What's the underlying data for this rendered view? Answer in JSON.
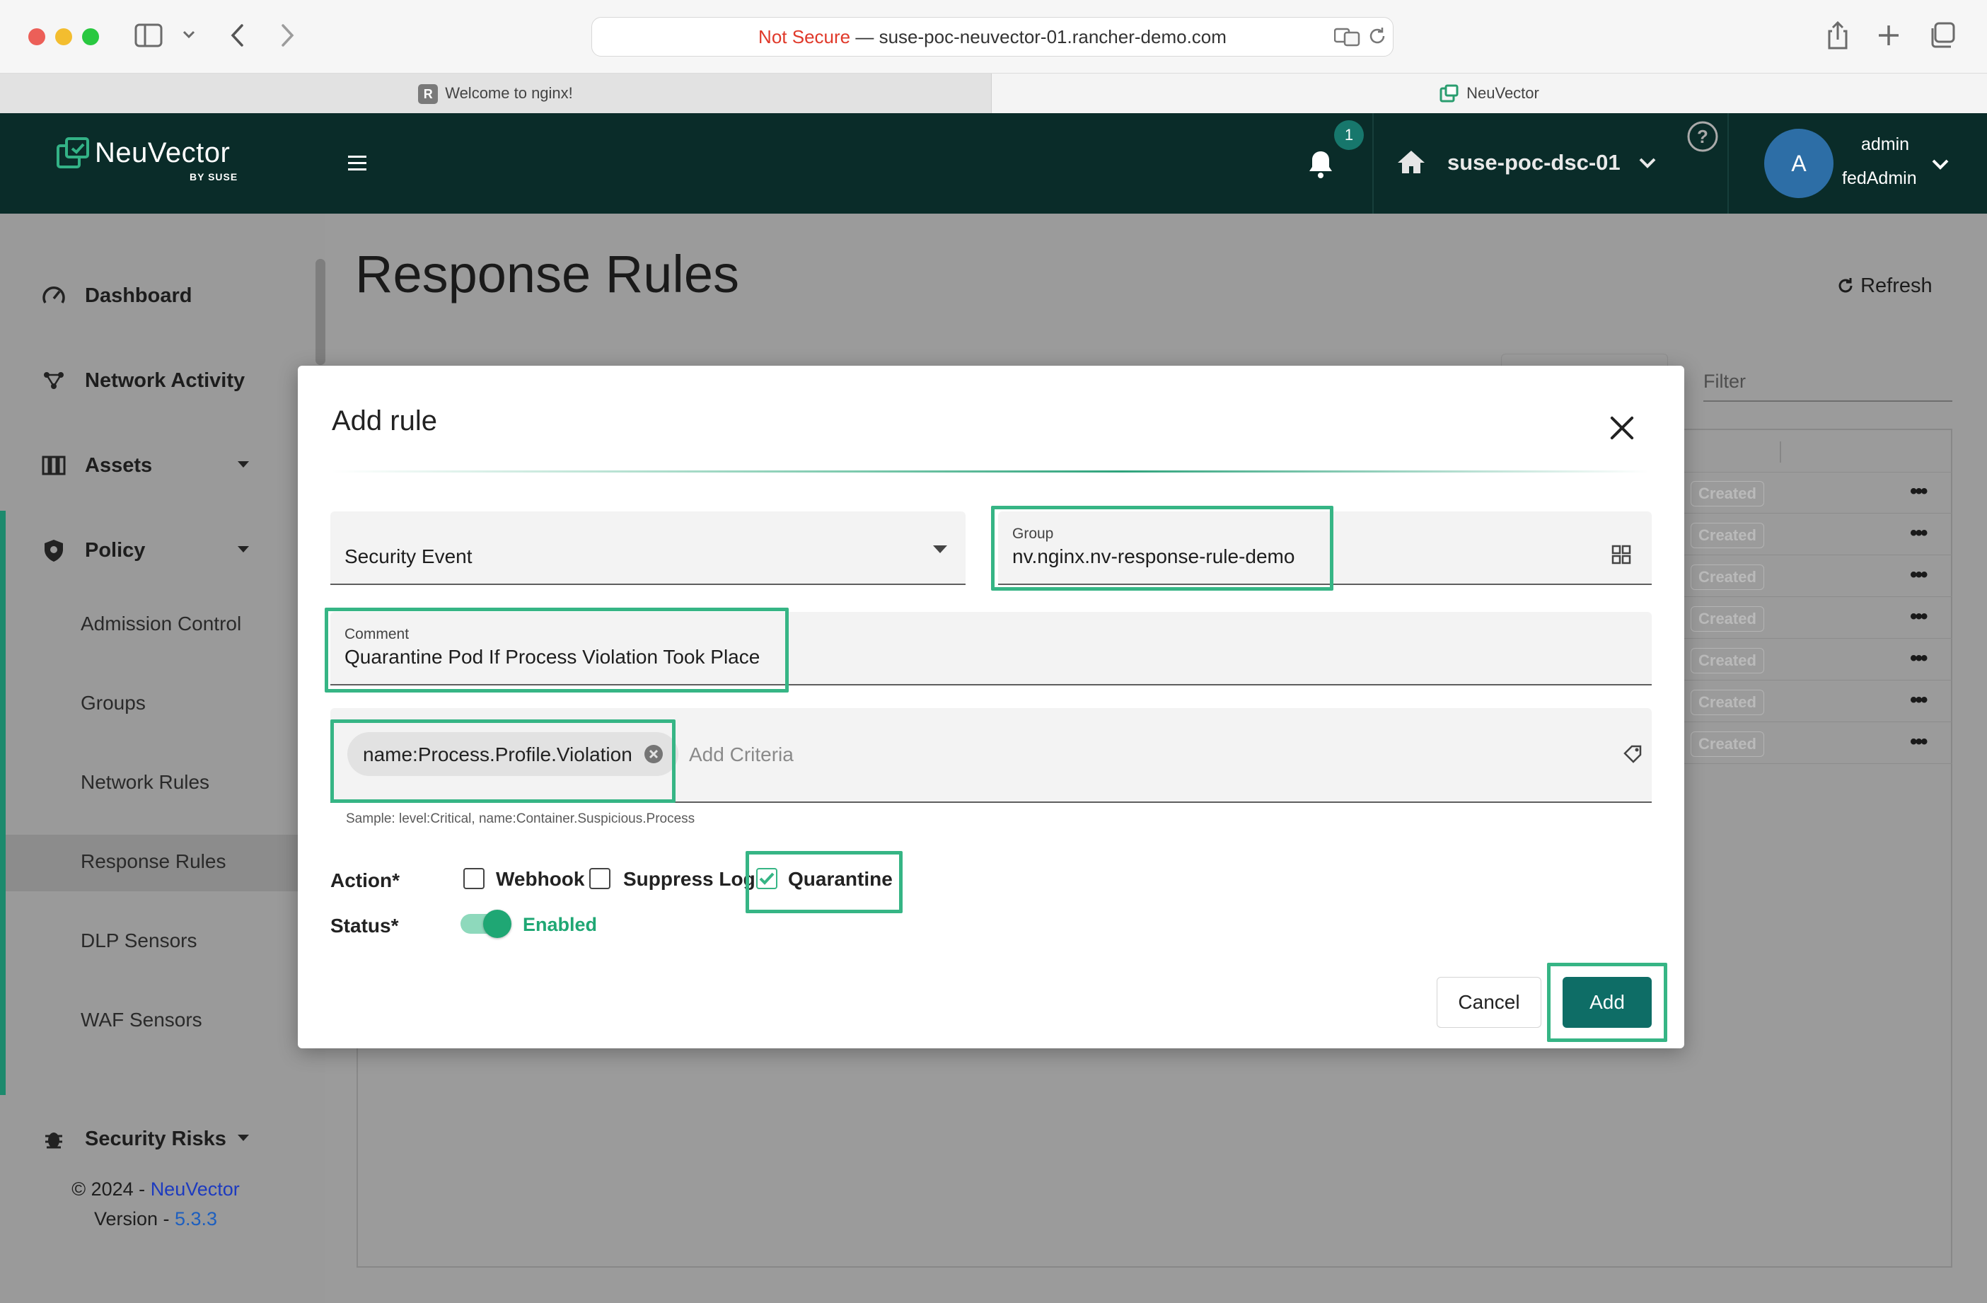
{
  "browser": {
    "url_warning": "Not Secure",
    "url_separator": "—",
    "url_host": "suse-poc-neuvector-01.rancher-demo.com",
    "tabs": [
      {
        "label": "Welcome to nginx!",
        "favicon": "R"
      },
      {
        "label": "NeuVector"
      }
    ]
  },
  "app": {
    "logo_text": "NeuVector",
    "logo_sub": "BY SUSE",
    "notification_count": "1",
    "cluster_name": "suse-poc-dsc-01",
    "user": {
      "initial": "A",
      "name": "admin",
      "role": "fedAdmin"
    }
  },
  "sidebar": {
    "items": [
      {
        "label": "Dashboard"
      },
      {
        "label": "Network Activity"
      },
      {
        "label": "Assets"
      },
      {
        "label": "Policy"
      }
    ],
    "policy_sub": [
      {
        "label": "Admission Control"
      },
      {
        "label": "Groups"
      },
      {
        "label": "Network Rules"
      },
      {
        "label": "Response Rules"
      },
      {
        "label": "DLP Sensors"
      },
      {
        "label": "WAF Sensors"
      }
    ],
    "security_risks": "Security Risks",
    "footer": {
      "copyright": "© 2024 - ",
      "brand": "NeuVector",
      "version_label": "Version - ",
      "version": "5.3.3"
    }
  },
  "page": {
    "title": "Response Rules",
    "refresh_label": "Refresh",
    "filter_placeholder": "Filter",
    "row_badge": "Created",
    "row_actions": "•••"
  },
  "modal": {
    "title": "Add rule",
    "event_type": "Security Event",
    "group_label": "Group",
    "group_value": "nv.nginx.nv-response-rule-demo",
    "comment_label": "Comment",
    "comment_value": "Quarantine Pod If Process Violation Took Place",
    "criteria_chip": "name:Process.Profile.Violation",
    "criteria_placeholder": "Add Criteria",
    "sample_text": "Sample: level:Critical, name:Container.Suspicious.Process",
    "action_label": "Action*",
    "actions": [
      {
        "label": "Webhook",
        "checked": false
      },
      {
        "label": "Suppress Log",
        "checked": false
      },
      {
        "label": "Quarantine",
        "checked": true
      }
    ],
    "status_label": "Status*",
    "status_value": "Enabled",
    "status_on": true,
    "cancel_label": "Cancel",
    "add_label": "Add"
  },
  "colors": {
    "header_bg": "#0a2c29",
    "accent_green": "#36b585",
    "primary_button": "#0e6d66",
    "brand_link": "#1d3bbf",
    "not_secure": "#e0392a"
  }
}
